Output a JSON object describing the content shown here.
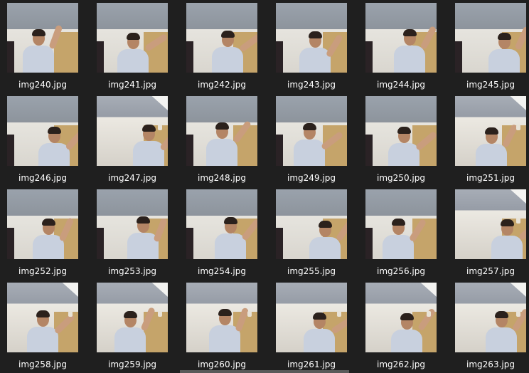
{
  "files": [
    {
      "name": "img240.jpg",
      "variant": "a",
      "curl": false
    },
    {
      "name": "img241.jpg",
      "variant": "a",
      "curl": false
    },
    {
      "name": "img242.jpg",
      "variant": "a",
      "curl": false
    },
    {
      "name": "img243.jpg",
      "variant": "a",
      "curl": false
    },
    {
      "name": "img244.jpg",
      "variant": "a",
      "curl": false
    },
    {
      "name": "img245.jpg",
      "variant": "a",
      "curl": false
    },
    {
      "name": "img246.jpg",
      "variant": "a",
      "curl": false
    },
    {
      "name": "img247.jpg",
      "variant": "b",
      "curl": true
    },
    {
      "name": "img248.jpg",
      "variant": "a",
      "curl": false
    },
    {
      "name": "img249.jpg",
      "variant": "a",
      "curl": false
    },
    {
      "name": "img250.jpg",
      "variant": "a",
      "curl": false
    },
    {
      "name": "img251.jpg",
      "variant": "b",
      "curl": true
    },
    {
      "name": "img252.jpg",
      "variant": "a",
      "curl": false
    },
    {
      "name": "img253.jpg",
      "variant": "a",
      "curl": false
    },
    {
      "name": "img254.jpg",
      "variant": "a",
      "curl": false
    },
    {
      "name": "img255.jpg",
      "variant": "a",
      "curl": false
    },
    {
      "name": "img256.jpg",
      "variant": "a",
      "curl": false
    },
    {
      "name": "img257.jpg",
      "variant": "b",
      "curl": true
    },
    {
      "name": "img258.jpg",
      "variant": "b",
      "curl": true
    },
    {
      "name": "img259.jpg",
      "variant": "b",
      "curl": true
    },
    {
      "name": "img260.jpg",
      "variant": "b",
      "curl": false
    },
    {
      "name": "img261.jpg",
      "variant": "b",
      "curl": false
    },
    {
      "name": "img262.jpg",
      "variant": "b",
      "curl": true
    },
    {
      "name": "img263.jpg",
      "variant": "b",
      "curl": true
    }
  ],
  "colors": {
    "background": "#1f1f1f",
    "label": "#ffffff"
  }
}
